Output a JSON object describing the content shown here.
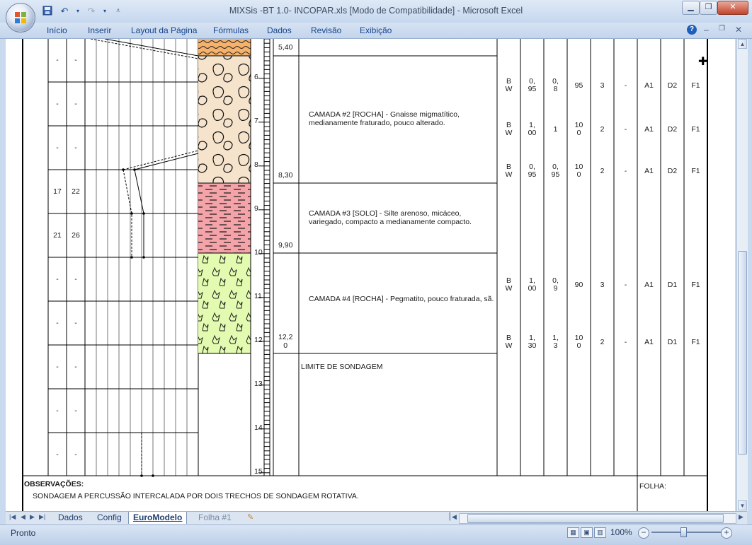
{
  "window": {
    "title": "MIXSis -BT 1.0- INCOPAR.xls  [Modo de Compatibilidade] - Microsoft Excel",
    "controls": [
      "minimize-icon",
      "maximize-icon",
      "close-icon"
    ]
  },
  "qat": {
    "save_icon": "save-icon",
    "undo_icon": "undo-icon",
    "redo_icon": "redo-icon",
    "customize_icon": "chevron-down-icon"
  },
  "ribbon": {
    "tabs": [
      "Início",
      "Inserir",
      "Layout da Página",
      "Fórmulas",
      "Dados",
      "Revisão",
      "Exibição"
    ]
  },
  "sheet": {
    "left_rows": [
      {
        "a": "-",
        "b": "-"
      },
      {
        "a": "-",
        "b": "-"
      },
      {
        "a": "-",
        "b": "-"
      },
      {
        "a": "17",
        "b": "22"
      },
      {
        "a": "21",
        "b": "26"
      },
      {
        "a": "-",
        "b": "-"
      },
      {
        "a": "-",
        "b": "-"
      },
      {
        "a": "-",
        "b": "-"
      },
      {
        "a": "-",
        "b": "-"
      },
      {
        "a": "-",
        "b": "-"
      }
    ],
    "depth_marks": [
      "6",
      "7",
      "8",
      "9",
      "10",
      "11",
      "12",
      "13",
      "14",
      "15"
    ],
    "layer_depths": [
      "5,40",
      "8,30",
      "9,90",
      "12,2\n0"
    ],
    "descriptions": [
      "CAMADA #2 [ROCHA] - Gnaisse migmatítico, medianamente fraturado, pouco alterado.",
      "CAMADA #3 [SOLO] - Silte arenoso, micáceo, variegado, compacto a medianamente compacto.",
      "CAMADA #4 [ROCHA] - Pegmatito, pouco fraturada, sã.",
      "LIMITE DE SONDAGEM"
    ],
    "right_rows": [
      [
        "B\nW",
        "0,\n95",
        "0,\n8",
        "95",
        "3",
        "-",
        "A1",
        "D2",
        "F1"
      ],
      [
        "B\nW",
        "1,\n00",
        "1",
        "10\n0",
        "2",
        "-",
        "A1",
        "D2",
        "F1"
      ],
      [
        "B\nW",
        "0,\n95",
        "0,\n95",
        "10\n0",
        "2",
        "-",
        "A1",
        "D2",
        "F1"
      ],
      [
        "B\nW",
        "1,\n00",
        "0,\n9",
        "90",
        "3",
        "-",
        "A1",
        "D1",
        "F1"
      ],
      [
        "B\nW",
        "1,\n30",
        "1,\n3",
        "10\n0",
        "2",
        "-",
        "A1",
        "D1",
        "F1"
      ]
    ],
    "observations_label": "OBSERVAÇÕES:",
    "observations_text": "SONDAGEM A PERCUSSÃO INTERCALADA POR DOIS TRECHOS DE SONDAGEM ROTATIVA.",
    "folha_label": "FOLHA:"
  },
  "sheet_tabs": [
    "Dados",
    "Config",
    "EuroModelo",
    "Folha #1"
  ],
  "status": {
    "text": "Pronto",
    "zoom": "100%"
  }
}
